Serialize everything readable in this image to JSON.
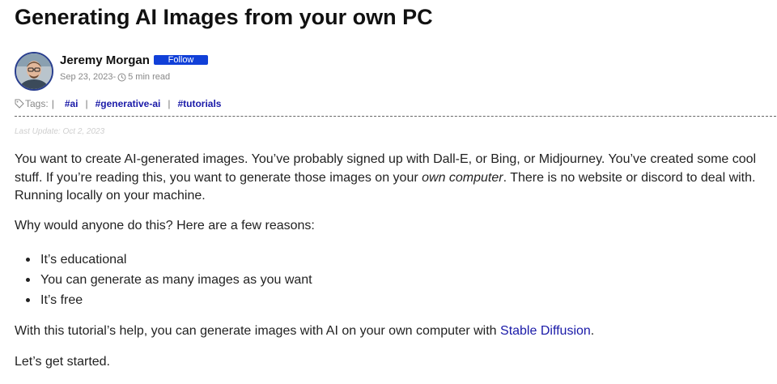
{
  "article": {
    "title": "Generating AI Images from your own PC",
    "author": {
      "name": "Jeremy Morgan",
      "follow_label": "Follow",
      "date": "Sep 23, 2023",
      "date_sep": " -",
      "read_time": "5 min read",
      "avatar_icon": "avatar-photo"
    },
    "tags": {
      "label": "Tags:",
      "separator": "|",
      "items": [
        "#ai",
        "#generative-ai",
        "#tutorials"
      ],
      "icon": "tag-icon"
    },
    "last_update": "Last Update: Oct 2, 2023",
    "body": {
      "p1_before": "You want to create AI-generated images. You’ve probably signed up with Dall-E, or Bing, or Midjourney. You’ve created some cool stuff. If you’re reading this, you want to generate those images on your ",
      "p1_emph": "own computer",
      "p1_after": ". There is no website or discord to deal with. Running locally on your machine.",
      "p2": "Why would anyone do this? Here are a few reasons:",
      "reasons": [
        "It’s educational",
        "You can generate as many images as you want",
        "It’s free"
      ],
      "p3_before": "With this tutorial’s help, you can generate images with AI on your own computer with ",
      "p3_link": "Stable Diffusion",
      "p3_after": ".",
      "p4": "Let’s get started."
    }
  },
  "colors": {
    "follow_button": "#1140d8",
    "link": "#1a1aa8",
    "avatar_border": "#2a3f8f"
  }
}
